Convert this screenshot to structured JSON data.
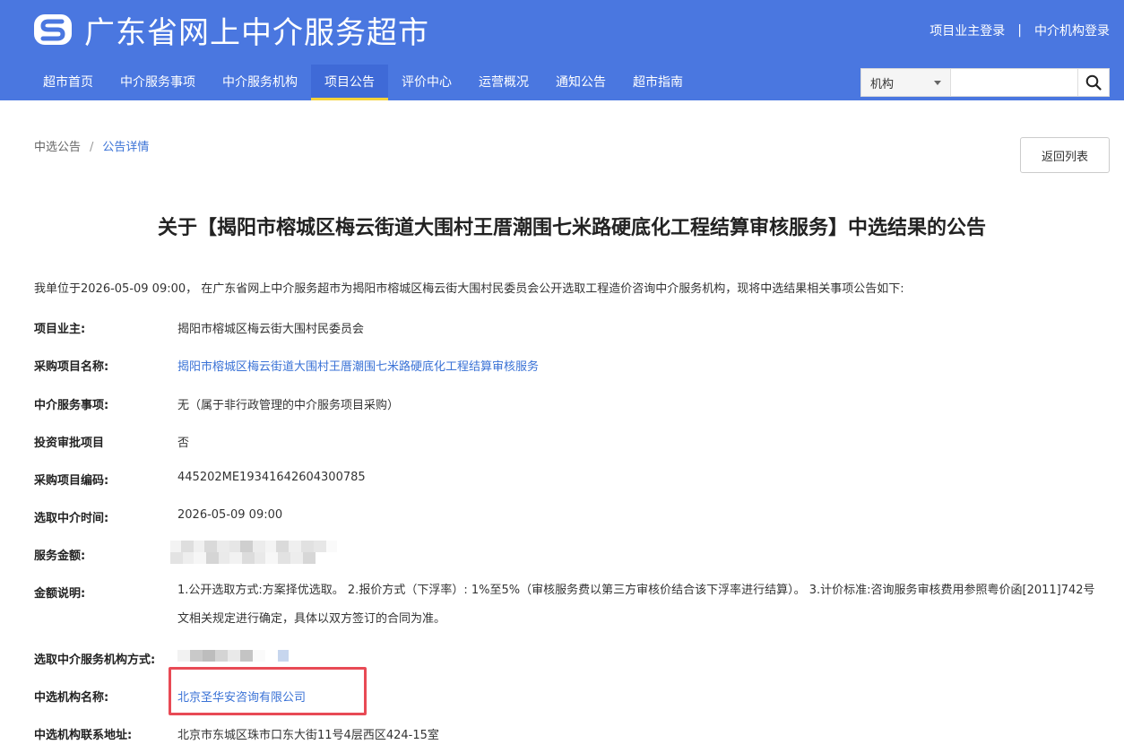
{
  "header": {
    "site_title": "广东省网上中介服务超市",
    "logo_icon": "s-logo-icon",
    "owner_login": "项目业主登录",
    "separator": "|",
    "agency_login": "中介机构登录",
    "nav": [
      {
        "label": "超市首页",
        "active": false
      },
      {
        "label": "中介服务事项",
        "active": false
      },
      {
        "label": "中介服务机构",
        "active": false
      },
      {
        "label": "项目公告",
        "active": true
      },
      {
        "label": "评价中心",
        "active": false
      },
      {
        "label": "运营概况",
        "active": false
      },
      {
        "label": "通知公告",
        "active": false
      },
      {
        "label": "超市指南",
        "active": false
      }
    ],
    "search": {
      "select_value": "机构",
      "input_value": "",
      "placeholder": "",
      "button_icon": "search-icon"
    },
    "colors": {
      "brand": "#4a77e0",
      "active_underline": "#f5d33a"
    }
  },
  "breadcrumb": {
    "parent": "中选公告",
    "separator": "/",
    "current": "公告详情"
  },
  "back_button": "返回列表",
  "title": "关于【揭阳市榕城区梅云街道大围村王厝潮围七米路硬底化工程结算审核服务】中选结果的公告",
  "intro": "我单位于2026-05-09 09:00， 在广东省网上中介服务超市为揭阳市榕城区梅云街大围村民委员会公开选取工程造价咨询中介服务机构，现将中选结果相关事项公告如下:",
  "fields": {
    "owner": {
      "label": "项目业主:",
      "value": "揭阳市榕城区梅云街大围村民委员会"
    },
    "project_name": {
      "label": "采购项目名称:",
      "value": "揭阳市榕城区梅云街道大围村王厝潮围七米路硬底化工程结算审核服务"
    },
    "service_item": {
      "label": "中介服务事项:",
      "value": "无（属于非行政管理的中介服务项目采购）"
    },
    "investment": {
      "label": "投资审批项目",
      "value": "否"
    },
    "project_code": {
      "label": "采购项目编码:",
      "value": "445202ME19341642604300785"
    },
    "select_time": {
      "label": "选取中介时间:",
      "value": "2026-05-09 09:00"
    },
    "amount": {
      "label": "服务金额:",
      "value": ""
    },
    "amount_note": {
      "label": "金额说明:",
      "value": "1.公开选取方式:方案择优选取。 2.报价方式（下浮率）: 1%至5%（审核服务费以第三方审核价结合该下浮率进行结算）。 3.计价标准:咨询服务审核费用参照粤价函[2011]742号文相关规定进行确定，具体以双方签订的合同为准。"
    },
    "select_method": {
      "label": "选取中介服务机构方式:",
      "value": ""
    },
    "winner": {
      "label": "中选机构名称:",
      "value": "北京圣华安咨询有限公司"
    },
    "winner_address": {
      "label": "中选机构联系地址:",
      "value": "北京市东城区珠市口东大街11号4层西区424-15室"
    }
  },
  "annotations": {
    "highlight_color": "#e84a55"
  }
}
